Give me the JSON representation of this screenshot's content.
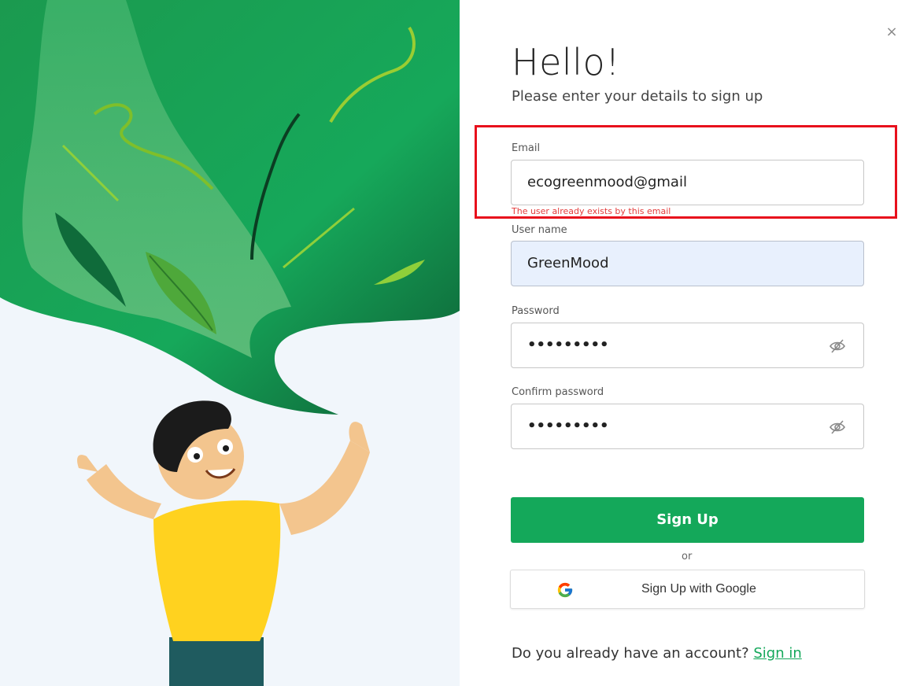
{
  "modal": {
    "title": "Hello!",
    "subtitle": "Please enter your details to sign up",
    "close_symbol": "×"
  },
  "form": {
    "email": {
      "label": "Email",
      "value": "ecogreenmood@gmail",
      "error": "The user already exists by this email"
    },
    "username": {
      "label": "User name",
      "value": "GreenMood"
    },
    "password": {
      "label": "Password",
      "value": "•••••••••"
    },
    "confirm_password": {
      "label": "Confirm password",
      "value": "•••••••••"
    }
  },
  "buttons": {
    "sign_up": "Sign Up",
    "or": "or",
    "google": "Sign Up with Google"
  },
  "footer": {
    "question": "Do you already have an account?",
    "link": "Sign in"
  },
  "colors": {
    "accent": "#14a85a",
    "error": "#e33c3c",
    "annotation": "#e8101c"
  },
  "icons": [
    "close-icon",
    "eye-off-icon",
    "google-logo-icon"
  ]
}
